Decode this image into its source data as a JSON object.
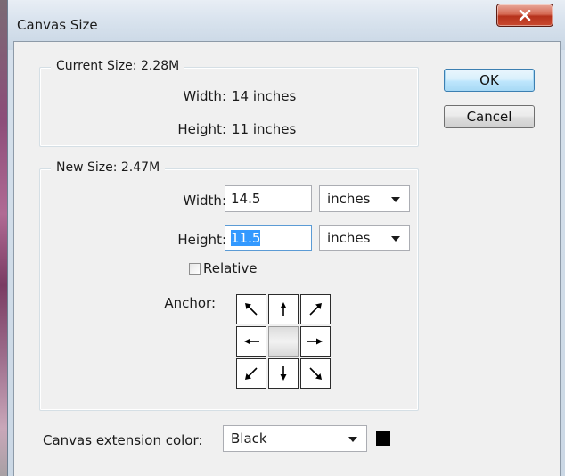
{
  "window": {
    "title": "Canvas Size"
  },
  "current_size": {
    "legend": "Current Size: 2.28M",
    "width_label": "Width:",
    "width_value": "14 inches",
    "height_label": "Height:",
    "height_value": "11 inches"
  },
  "new_size": {
    "legend": "New Size: 2.47M",
    "width_label": "Width:",
    "width_value": "14.5",
    "width_unit": "inches",
    "height_label": "Height:",
    "height_value": "11.5",
    "height_unit": "inches",
    "relative_label": "Relative",
    "relative_checked": false,
    "anchor_label": "Anchor:",
    "anchor_cells": [
      {
        "icon": "arrow-up-left-icon"
      },
      {
        "icon": "arrow-up-icon"
      },
      {
        "icon": "arrow-up-right-icon"
      },
      {
        "icon": "arrow-left-icon"
      },
      {
        "icon": "anchor-center"
      },
      {
        "icon": "arrow-right-icon"
      },
      {
        "icon": "arrow-down-left-icon"
      },
      {
        "icon": "arrow-down-icon"
      },
      {
        "icon": "arrow-down-right-icon"
      }
    ]
  },
  "extension": {
    "label": "Canvas extension color:",
    "value": "Black",
    "swatch_color": "#000000"
  },
  "buttons": {
    "ok": "OK",
    "cancel": "Cancel"
  }
}
